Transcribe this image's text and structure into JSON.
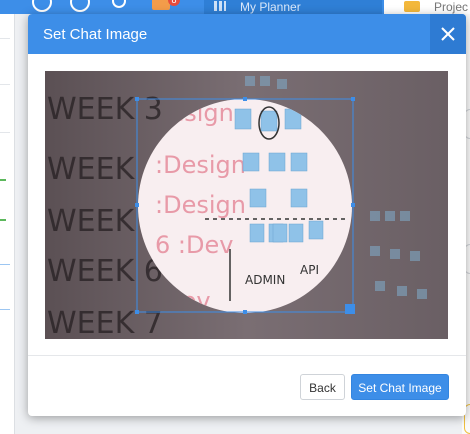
{
  "app": {
    "topbar": {
      "planner_label": "My Planner",
      "project_label": "Projec",
      "notification_count": "8"
    }
  },
  "dialog": {
    "title": "Set Chat Image",
    "close_icon": "close-icon",
    "image": {
      "board_text": [
        "WEEK 3 :Design",
        "WEEK 4 :Design",
        "WEEK 5 :Design",
        "WEEK 6 :Dev",
        "WEEK 7 :Dev",
        "ADMIN",
        "API"
      ]
    },
    "buttons": {
      "back": "Back",
      "set": "Set Chat Image"
    }
  },
  "colors": {
    "primary": "#3d8ee8",
    "primary_dark": "#2e7bd3"
  }
}
